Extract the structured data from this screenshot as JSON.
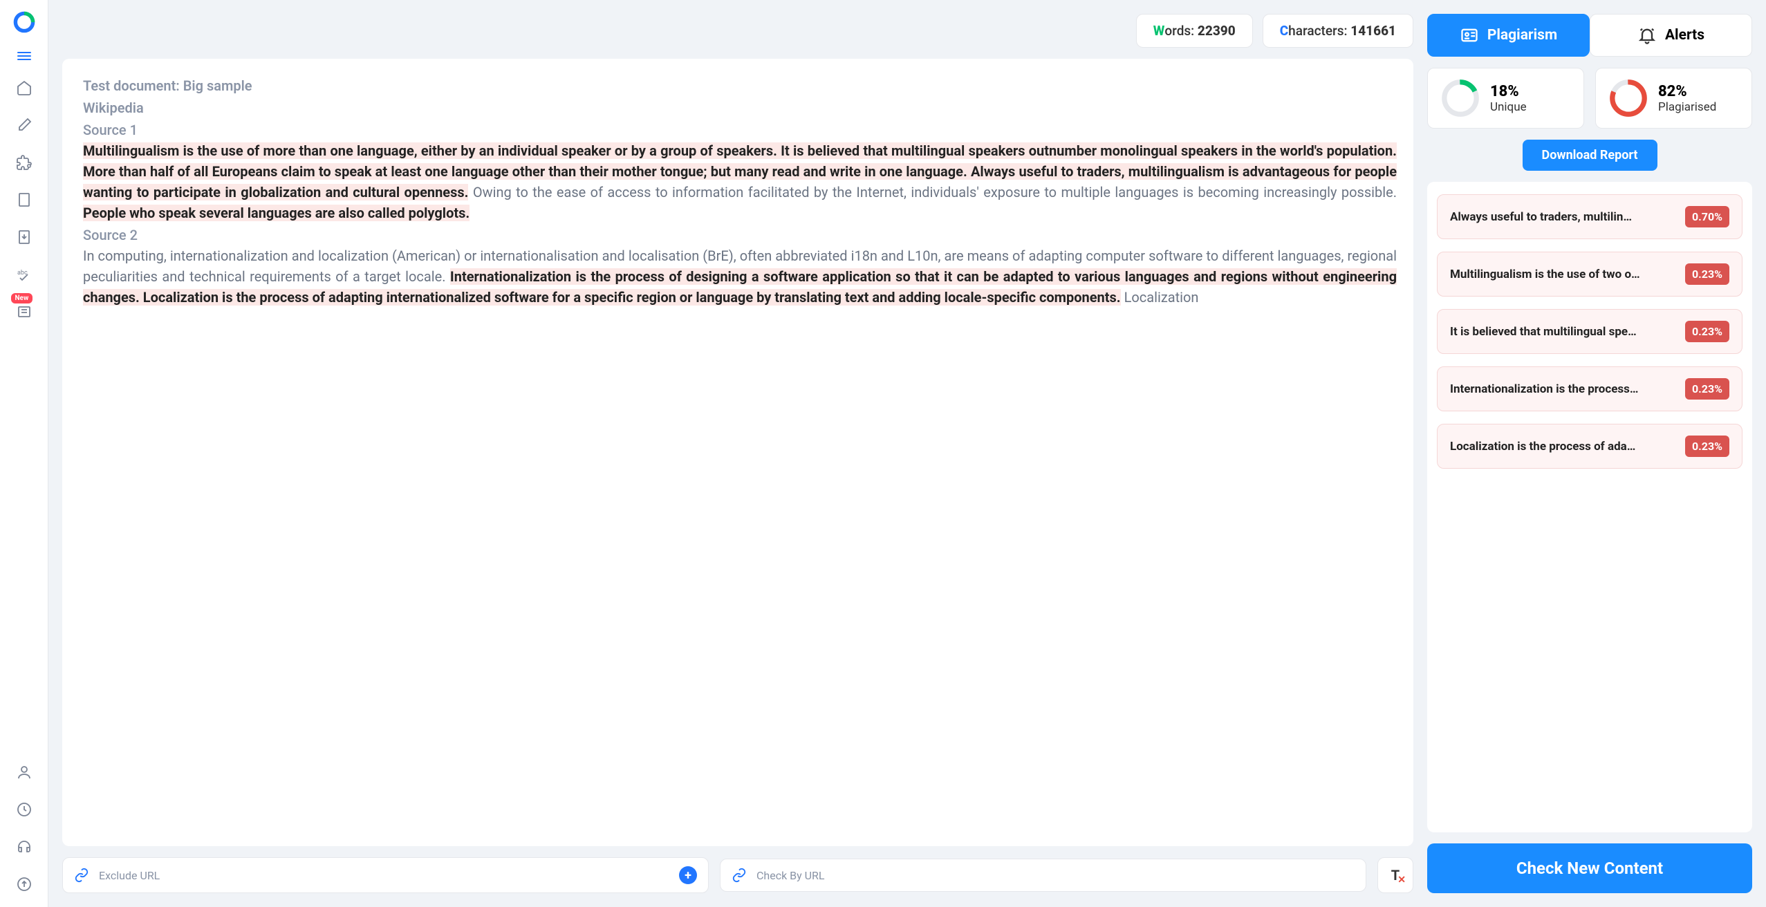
{
  "stats": {
    "words_label": "ords: ",
    "words_first": "W",
    "words_value": "22390",
    "chars_label": "haracters: ",
    "chars_first": "C",
    "chars_value": "141661"
  },
  "document": {
    "title": "Test document: Big sample",
    "subtitle": "Wikipedia",
    "source1_label": "Source 1",
    "p1_seg1": "Multilingualism is the use of more than one language, either by an individual speaker or by a group of speakers.",
    "p1_seg2": " It is believed that multilingual speakers outnumber monolingual speakers in the world's population.",
    "p1_seg3": " More than half of all Europeans claim to speak at least one language other than their mother tongue; but many read and write in one language. Always useful to traders, multilingualism is advantageous for people wanting to participate in globalization and cultural openness.",
    "p1_seg4": " Owing to the ease of access to information facilitated by the Internet, individuals' exposure to multiple languages is becoming increasingly possible. ",
    "p1_seg5": "People who speak several languages are also called polyglots.",
    "source2_label": "Source 2",
    "p2_seg1": "In computing, internationalization and localization (American) or internationalisation and localisation (BrE), often abbreviated i18n and L10n, are means of adapting computer software to different languages, regional peculiarities and technical requirements of a target locale. ",
    "p2_seg2": "Internationalization is the process of designing a software application so that it can be adapted to various languages and regions without engineering changes. Localization is the process of adapting internationalized software for a specific region or language by translating text and adding locale-specific components.",
    "p2_seg3": " Localization"
  },
  "inputs": {
    "exclude_placeholder": "Exclude URL",
    "checkby_placeholder": "Check By URL"
  },
  "tabs": {
    "plagiarism": "Plagiarism",
    "alerts": "Alerts"
  },
  "scores": {
    "unique_pct": "18%",
    "unique_label": "Unique",
    "plag_pct": "82%",
    "plag_label": "Plagiarised"
  },
  "download_label": "Download Report",
  "results": [
    {
      "text": "Always useful to traders, multilin…",
      "pct": "0.70%"
    },
    {
      "text": "Multilingualism is the use of two o…",
      "pct": "0.23%"
    },
    {
      "text": "It is believed that multilingual spe…",
      "pct": "0.23%"
    },
    {
      "text": "Internationalization is the process…",
      "pct": "0.23%"
    },
    {
      "text": "Localization is the process of ada…",
      "pct": "0.23%"
    }
  ],
  "check_label": "Check New Content",
  "new_badge": "New"
}
